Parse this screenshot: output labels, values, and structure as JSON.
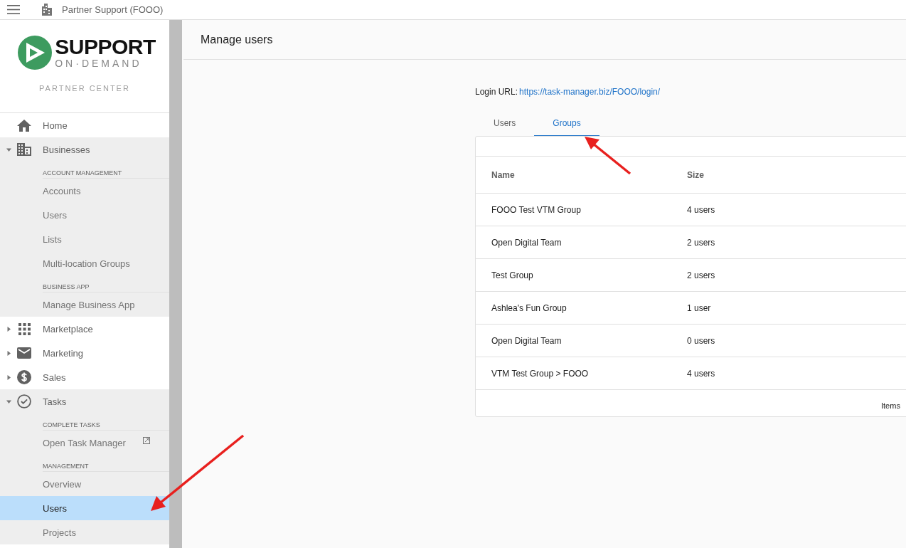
{
  "top_bar": {
    "title": "Partner Support (FOOO)"
  },
  "logo": {
    "brand": "SUPPORT",
    "tagline": "ON·DEMAND",
    "subtitle": "PARTNER CENTER"
  },
  "sidebar": {
    "items": [
      {
        "label": "Home",
        "kind": "link"
      },
      {
        "label": "Businesses",
        "kind": "group",
        "expanded": true,
        "sections": [
          {
            "heading": "ACCOUNT MANAGEMENT",
            "items": [
              {
                "label": "Accounts",
                "selected": false,
                "external": false
              },
              {
                "label": "Users",
                "selected": false,
                "external": false
              },
              {
                "label": "Lists",
                "selected": false,
                "external": false
              },
              {
                "label": "Multi-location Groups",
                "selected": false,
                "external": false
              }
            ]
          },
          {
            "heading": "BUSINESS APP",
            "items": [
              {
                "label": "Manage Business App",
                "selected": false,
                "external": false
              }
            ]
          }
        ]
      },
      {
        "label": "Marketplace",
        "kind": "group",
        "expanded": false
      },
      {
        "label": "Marketing",
        "kind": "group",
        "expanded": false
      },
      {
        "label": "Sales",
        "kind": "group",
        "expanded": false
      },
      {
        "label": "Tasks",
        "kind": "group",
        "expanded": true,
        "sections": [
          {
            "heading": "COMPLETE TASKS",
            "items": [
              {
                "label": "Open Task Manager",
                "selected": false,
                "external": true
              }
            ]
          },
          {
            "heading": "MANAGEMENT",
            "items": [
              {
                "label": "Overview",
                "selected": false,
                "external": false
              },
              {
                "label": "Users",
                "selected": true,
                "external": false
              },
              {
                "label": "Projects",
                "selected": false,
                "external": false
              }
            ]
          }
        ]
      }
    ]
  },
  "page_title": "Manage users",
  "login": {
    "label": "Login URL:",
    "url": "https://task-manager.biz/FOOO/login/"
  },
  "tabs": [
    {
      "label": "Users",
      "selected": false
    },
    {
      "label": "Groups",
      "selected": true
    }
  ],
  "table": {
    "columns": [
      "Name",
      "Size"
    ],
    "rows": [
      [
        "FOOO Test VTM Group",
        "4 users"
      ],
      [
        "Open Digital Team",
        "2 users"
      ],
      [
        "Test Group",
        "2 users"
      ],
      [
        "Ashlea's Fun Group",
        "1 user"
      ],
      [
        "Open Digital Team",
        "0 users"
      ],
      [
        "VTM Test Group > FOOO",
        "4 users"
      ]
    ],
    "footer": "Items"
  }
}
